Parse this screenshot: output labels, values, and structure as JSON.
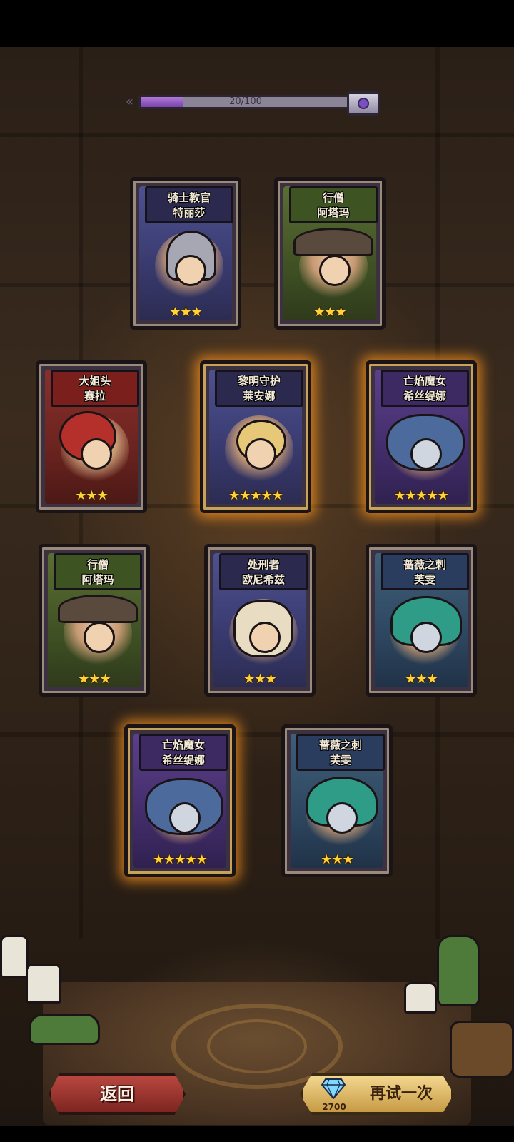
{
  "progress": {
    "text": "20/100",
    "value": 20,
    "max": 100
  },
  "cards": [
    {
      "title": "骑士教官",
      "name": "特丽莎",
      "stars": "★★★",
      "frame": "purple",
      "glow": false,
      "art": "helmet"
    },
    {
      "title": "行僧",
      "name": "阿塔玛",
      "stars": "★★★",
      "frame": "green",
      "glow": false,
      "art": "hat"
    },
    {
      "title": "大姐头",
      "name": "赛拉",
      "stars": "★★★",
      "frame": "red",
      "glow": false,
      "art": "hair-red"
    },
    {
      "title": "黎明守护",
      "name": "莱安娜",
      "stars": "★★★★★",
      "frame": "purple",
      "glow": true,
      "art": "hair-blonde"
    },
    {
      "title": "亡焰魔女",
      "name": "希丝缇娜",
      "stars": "★★★★★",
      "frame": "violet",
      "glow": true,
      "art": "hair-blue"
    },
    {
      "title": "行僧",
      "name": "阿塔玛",
      "stars": "★★★",
      "frame": "green",
      "glow": false,
      "art": "hat"
    },
    {
      "title": "处刑者",
      "name": "欧尼希兹",
      "stars": "★★★",
      "frame": "purple",
      "glow": false,
      "art": "bandage"
    },
    {
      "title": "蔷薇之刺",
      "name": "芙雯",
      "stars": "★★★",
      "frame": "teal",
      "glow": false,
      "art": "hair-teal"
    },
    {
      "title": "亡焰魔女",
      "name": "希丝缇娜",
      "stars": "★★★★★",
      "frame": "violet",
      "glow": true,
      "art": "hair-blue"
    },
    {
      "title": "蔷薇之刺",
      "name": "芙雯",
      "stars": "★★★",
      "frame": "teal",
      "glow": false,
      "art": "hair-teal"
    }
  ],
  "buttons": {
    "back_label": "返回",
    "retry_label": "再试一次",
    "retry_cost": "2700",
    "retry_cost_icon": "diamond-icon"
  },
  "colors": {
    "glow": "#ff961e",
    "progress_fill": "#9a5fd0",
    "back_button": "#9e352f",
    "retry_button": "#e0bb6a"
  }
}
